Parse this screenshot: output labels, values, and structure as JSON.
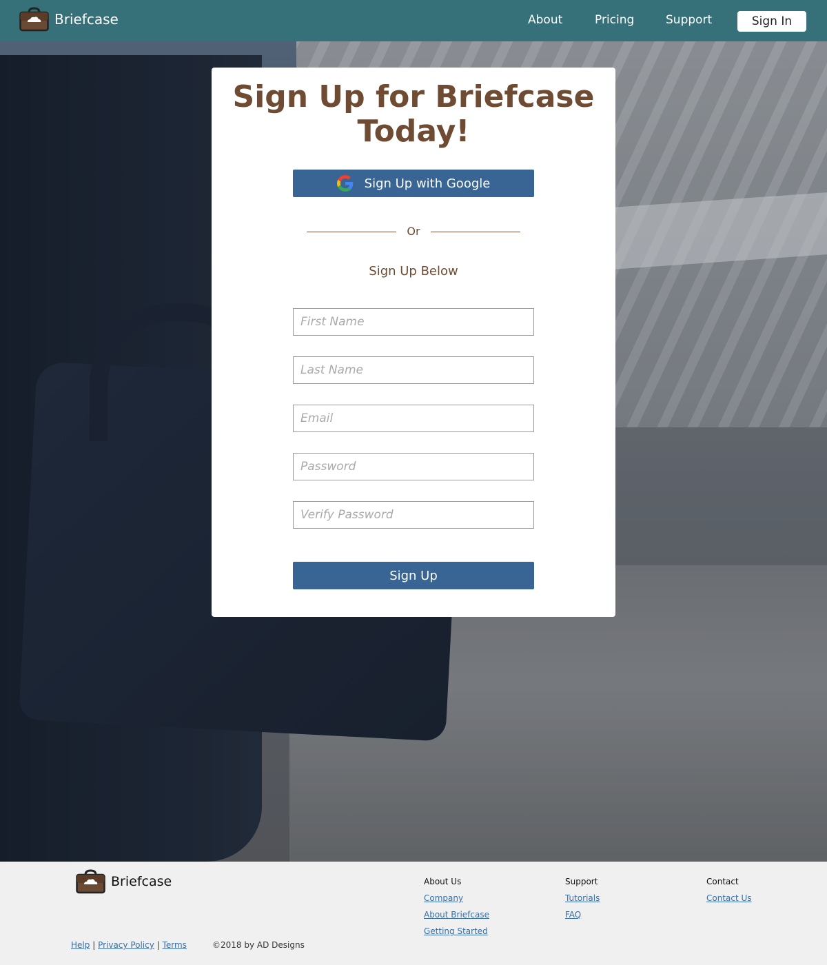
{
  "nav": {
    "brand": "Briefcase",
    "links": [
      "About",
      "Pricing",
      "Support"
    ],
    "signin_label": "Sign In"
  },
  "form": {
    "title": "Sign Up for Briefcase Today!",
    "google_label": "Sign Up with Google",
    "divider_text": "Or",
    "subhead": "Sign Up Below",
    "fields": {
      "first_name_placeholder": "First Name",
      "last_name_placeholder": "Last Name",
      "email_placeholder": "Email",
      "password_placeholder": "Password",
      "verify_password_placeholder": "Verify Password"
    },
    "submit_label": "Sign Up"
  },
  "footer": {
    "brand": "Briefcase",
    "columns": [
      {
        "heading": "About Us",
        "links": [
          "Company",
          "About Briefcase",
          "Getting Started"
        ]
      },
      {
        "heading": "Support",
        "links": [
          "Tutorials",
          "FAQ"
        ]
      },
      {
        "heading": "Contact",
        "links": [
          "Contact Us"
        ]
      }
    ],
    "legal_links": [
      "Help",
      "Privacy Policy",
      "Terms"
    ],
    "legal_separator": "|",
    "copyright": "©2018 by AD Designs"
  },
  "colors": {
    "nav_bg": "#367078",
    "accent_brown": "#6e4b32",
    "button_blue": "#386594",
    "link_blue": "#3a6ea5"
  },
  "icons": {
    "brand_logo": "briefcase-cloud-icon",
    "google": "google-g-icon"
  }
}
